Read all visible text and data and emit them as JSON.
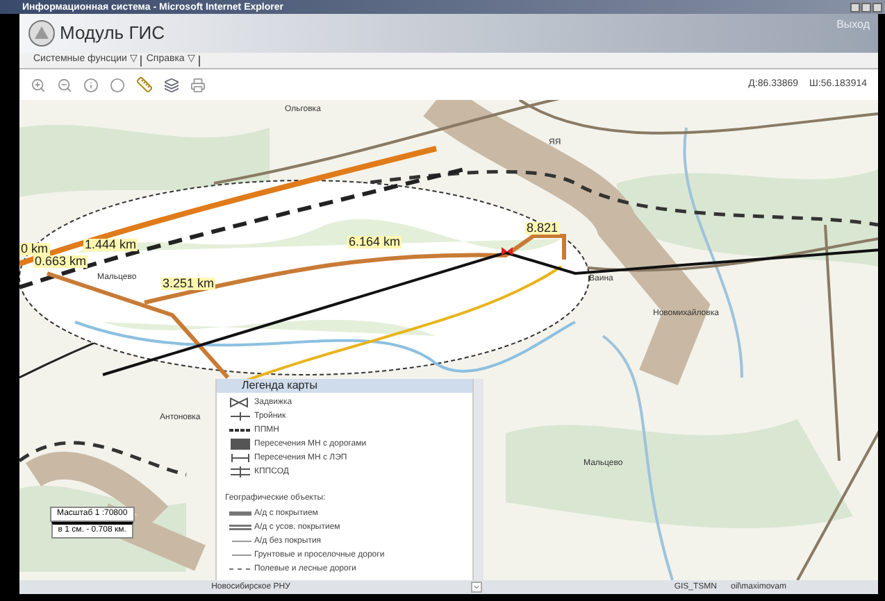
{
  "window": {
    "title": "Информационная система - Microsoft Internet Explorer"
  },
  "header": {
    "app_title": "Модуль ГИС",
    "logout": "Выход"
  },
  "menu": [
    {
      "label": "Системные фунсции ▽"
    },
    {
      "label": "Справка ▽"
    }
  ],
  "toolbar": {
    "longitude": "Д:86.33869",
    "latitude": "Ш:56.183914"
  },
  "map": {
    "place_labels": [
      {
        "text": "Ольговка"
      },
      {
        "text": "ЯЯ"
      },
      {
        "text": "Мальцево"
      },
      {
        "text": "Ваина"
      },
      {
        "text": "Новомихайловка"
      },
      {
        "text": "Антоновка"
      },
      {
        "text": "Мальцево"
      }
    ],
    "distance_labels": [
      {
        "text": "0 km"
      },
      {
        "text": "1.444 km"
      },
      {
        "text": "0.663 km"
      },
      {
        "text": "3.251 km"
      },
      {
        "text": "6.164 km"
      },
      {
        "text": "8.821"
      }
    ],
    "legend": {
      "title": "Легенда карты",
      "items": [
        {
          "kind": "valve",
          "label": "Задвижка"
        },
        {
          "kind": "tee",
          "label": "Тройник"
        },
        {
          "kind": "dashline",
          "label": "ППМН"
        },
        {
          "kind": "grid",
          "label": "Пересечения МН с дорогами"
        },
        {
          "kind": "pylon",
          "label": "Пересечения МН с ЛЭП"
        },
        {
          "kind": "station",
          "label": "КППСОД"
        },
        {
          "kind": "heading",
          "label": "Географические объекты:"
        },
        {
          "kind": "road",
          "label": "А/д с покрытием"
        },
        {
          "kind": "road2",
          "label": "А/д с усов. покрытием"
        },
        {
          "kind": "thin",
          "label": "А/д без покрытия"
        },
        {
          "kind": "thin",
          "label": "Грунтовые и проселочные дороги"
        },
        {
          "kind": "dashed",
          "label": "Полевые и лесные дороги"
        }
      ]
    },
    "scale": {
      "ratio": "Масштаб 1 :70800",
      "per_cm": "в 1 см. - 0.708 км."
    }
  },
  "status_bar": {
    "region": "Новосибирское РНУ",
    "database": "GIS_TSMN",
    "user": "oil\\maximovam"
  }
}
